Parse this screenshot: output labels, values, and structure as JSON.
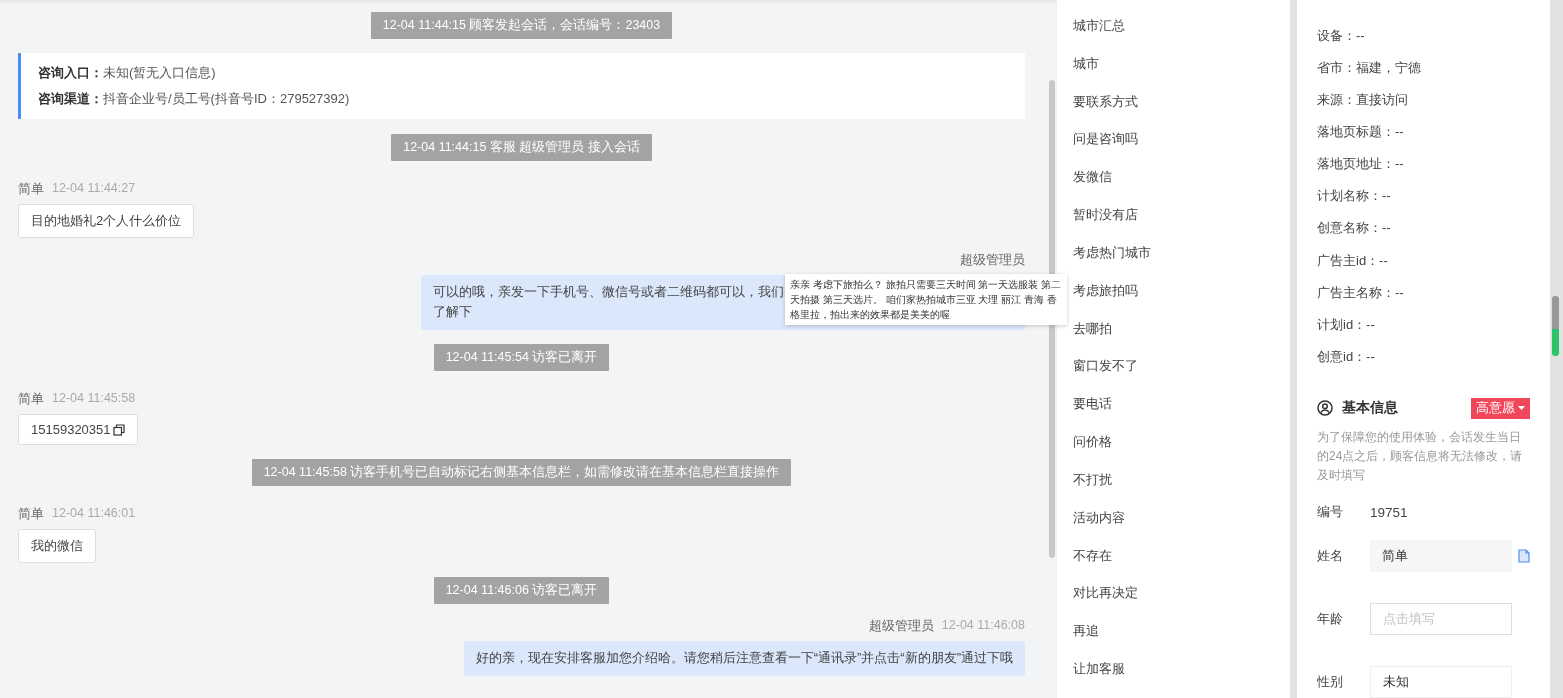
{
  "chat": {
    "messages": [
      {
        "kind": "system",
        "text": "12-04 11:44:15 顾客发起会话，会话编号：23403"
      },
      {
        "kind": "info",
        "rows": [
          {
            "label": "咨询入口：",
            "value": "未知(暂无入口信息)"
          },
          {
            "label": "咨询渠道：",
            "value": "抖音企业号/员工号(抖音号ID：279527392)"
          }
        ]
      },
      {
        "kind": "system",
        "text": "12-04 11:44:15 客服 超级管理员 接入会话"
      },
      {
        "kind": "visitor",
        "name": "简单",
        "time": "12-04 11:44:27",
        "text": "目的地婚礼2个人什么价位"
      },
      {
        "kind": "agent",
        "name": "超级管理员",
        "lines": [
          "可以的哦，亲发一下手机号、微信号或者二维码都可以，我们",
          "了解下"
        ],
        "tooltip": "亲亲 考虑下旅拍么？ 旅拍只需要三天时间 第一天选服装 第二天拍摄 第三天选片。 咱们家热拍城市三亚 大理 丽江 青海 香格里拉，拍出来的效果都是美美的喔"
      },
      {
        "kind": "system",
        "text": "12-04 11:45:54 访客已离开"
      },
      {
        "kind": "visitor",
        "name": "简单",
        "time": "12-04 11:45:58",
        "text": "15159320351",
        "copy": true
      },
      {
        "kind": "system",
        "text": "12-04 11:45:58 访客手机号已自动标记右侧基本信息栏，如需修改请在基本信息栏直接操作"
      },
      {
        "kind": "visitor",
        "name": "简单",
        "time": "12-04 11:46:01",
        "text": "我的微信"
      },
      {
        "kind": "system",
        "text": "12-04 11:46:06 访客已离开"
      },
      {
        "kind": "agent",
        "name": "超级管理员",
        "time": "12-04 11:46:08",
        "lines": [
          "好的亲，现在安排客服加您介绍哈。请您稍后注意查看一下“通讯录”并点击“新的朋友”通过下哦"
        ]
      }
    ]
  },
  "quick_replies": [
    "城市汇总",
    "城市",
    "要联系方式",
    "问是咨询吗",
    "发微信",
    "暂时没有店",
    "考虑热门城市",
    "考虑旅拍吗",
    "去哪拍",
    "窗口发不了",
    "要电话",
    "问价格",
    "不打扰",
    "活动内容",
    "不存在",
    "对比再决定",
    "再追",
    "让加客服"
  ],
  "source_info": {
    "rows": [
      "设备：--",
      "省市：福建，宁德",
      "来源：直接访问",
      "落地页标题：--",
      "落地页地址：--",
      "计划名称：--",
      "创意名称：--",
      "广告主id：--",
      "广告主名称：--",
      "计划id：--",
      "创意id：--"
    ]
  },
  "basic_info": {
    "title": "基本信息",
    "intent_tag": "高意愿",
    "notice": "为了保障您的使用体验，会话发生当日的24点之后，顾客信息将无法修改，请及时填写",
    "fields": [
      {
        "kind": "text",
        "label": "编号",
        "value": "19751"
      },
      {
        "kind": "filled",
        "label": "姓名",
        "value": "简单",
        "copy": true
      },
      {
        "kind": "input",
        "label": "年龄",
        "placeholder": "点击填写"
      },
      {
        "kind": "select",
        "label": "性别",
        "value": "未知"
      }
    ]
  }
}
